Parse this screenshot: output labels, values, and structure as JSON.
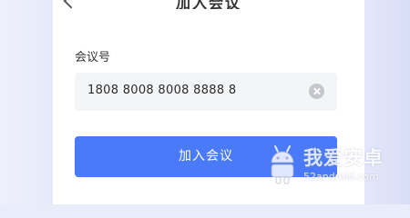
{
  "header": {
    "title": "加入会议"
  },
  "form": {
    "meeting_id_label": "会议号",
    "meeting_id_value": "1808 8008 8008 8888 8"
  },
  "actions": {
    "join_label": "加入会议"
  },
  "watermark": {
    "brand": "我爱安卓",
    "domain": "52android.com"
  },
  "colors": {
    "accent": "#4a7af7",
    "input_bg": "#f4f5f7",
    "page_bg": "#e9ecfb"
  }
}
